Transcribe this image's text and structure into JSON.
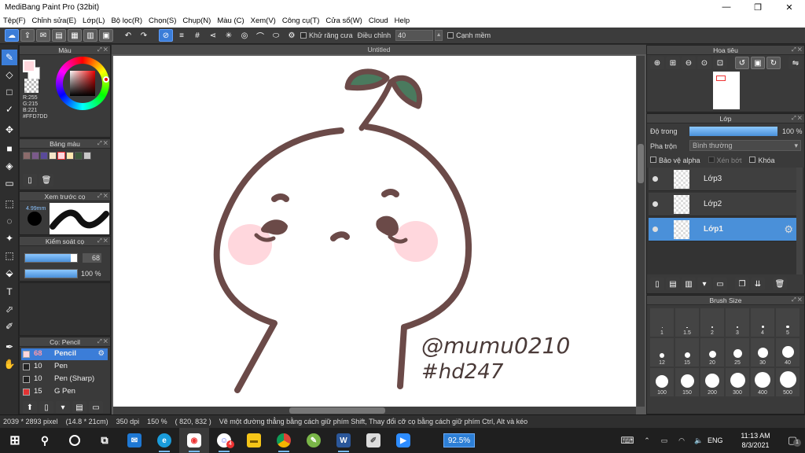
{
  "window": {
    "title": "MediBang Paint Pro (32bit)",
    "minimize": "—",
    "maximize": "❐",
    "close": "✕"
  },
  "menu": [
    "Tệp(F)",
    "Chỉnh sửa(E)",
    "Lớp(L)",
    "Bộ lọc(R)",
    "Chọn(S)",
    "Chụp(N)",
    "Màu (C)",
    "Xem(V)",
    "Công cụ(T)",
    "Cửa sổ(W)",
    "Cloud",
    "Help"
  ],
  "toolbar": {
    "antialias_label": "Khử răng cưa",
    "adjust_label": "Điều chỉnh",
    "adjust_value": "40",
    "edge_label": "Cạnh mềm"
  },
  "color_panel": {
    "title": "Màu",
    "r": "R:255",
    "g": "G:215",
    "b": "B:221",
    "hex": "#FFD7DD",
    "primary": "#ffd7dd",
    "secondary": "#ffffff"
  },
  "palette_panel": {
    "title": "Bảng màu",
    "swatches": [
      "#8b6b6b",
      "#7a5a8a",
      "#5a4a9a",
      "#f5e6c8",
      "#ffd7dd",
      "#ffe8b0",
      "#3c5a3c",
      "#c8c8c8"
    ]
  },
  "brush_preview_panel": {
    "title": "Xem trước cọ",
    "size": "4.99mm"
  },
  "brush_control_panel": {
    "title": "Kiểm soát cọ",
    "size_value": "68",
    "size_fraction": 0.88,
    "opacity_value": "100 %",
    "opacity_fraction": 1.0
  },
  "brush_list_panel": {
    "title": "Cọ: Pencil",
    "items": [
      {
        "size": "68",
        "name": "Pencil",
        "color": "#ffd7dd",
        "selected": true
      },
      {
        "size": "10",
        "name": "Pen",
        "color": "#222222",
        "selected": false
      },
      {
        "size": "10",
        "name": "Pen (Sharp)",
        "color": "#222222",
        "selected": false
      },
      {
        "size": "15",
        "name": "G Pen",
        "color": "#e33333",
        "selected": false
      }
    ]
  },
  "canvas": {
    "title": "Untitled",
    "signature": "@mumu0210",
    "hashtag": "#hd247"
  },
  "navigator_panel": {
    "title": "Hoa tiêu"
  },
  "layer_panel": {
    "title": "Lớp",
    "opacity_label": "Độ trong",
    "opacity_value": "100 %",
    "opacity_fraction": 1.0,
    "blend_label": "Pha trộn",
    "blend_value": "Bình thường",
    "protect_alpha": "Bảo vệ alpha",
    "clipping": "Xén bớt",
    "lock": "Khóa",
    "layers": [
      "Lớp3",
      "Lớp2",
      "Lớp1"
    ]
  },
  "brush_size_panel": {
    "title": "Brush Size",
    "sizes": [
      "1",
      "1.5",
      "2",
      "3",
      "4",
      "5",
      "12",
      "15",
      "20",
      "25",
      "30",
      "40",
      "100",
      "150",
      "200",
      "300",
      "400",
      "500"
    ]
  },
  "status": {
    "dimensions": "2039 * 2893 pixel",
    "physical": "(14.8 * 21cm)",
    "dpi": "350 dpi",
    "zoom": "150 %",
    "coords": "( 820, 832 )",
    "hint": "Vẽ một đường thẳng bằng cách giữ phím Shift, Thay đổi cỡ cọ bằng cách giữ phím Ctrl, Alt và kéo"
  },
  "taskbar": {
    "zoom_badge": "92.5%",
    "lang": "ENG",
    "time": "11:13 AM",
    "date": "8/3/2021",
    "notif_count": "1",
    "discord_badge": "4"
  }
}
